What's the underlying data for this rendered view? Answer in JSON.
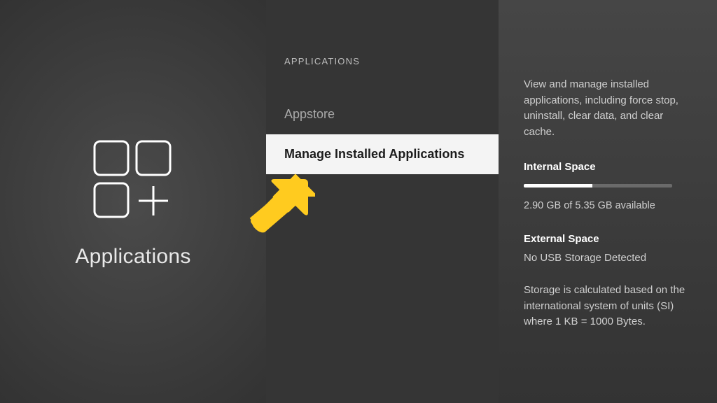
{
  "left": {
    "title": "Applications"
  },
  "middle": {
    "section_title": "APPLICATIONS",
    "items": {
      "appstore": {
        "label": "Appstore"
      },
      "manage_apps": {
        "label": "Manage Installed Applications"
      }
    }
  },
  "right": {
    "description": "View and manage installed applications, including force stop, uninstall, clear data, and clear cache.",
    "internal_space": {
      "title": "Internal Space",
      "used_gb": 2.9,
      "total_gb": 5.35,
      "available_line": "2.90 GB of 5.35 GB available",
      "fill_percent": 46
    },
    "external_space": {
      "title": "External Space",
      "status": "No USB Storage Detected"
    },
    "storage_note": "Storage is calculated based on the international system of units (SI) where 1 KB = 1000 Bytes."
  },
  "colors": {
    "accent_arrow": "#ffcb1f",
    "selected_bg": "#f4f4f4"
  }
}
